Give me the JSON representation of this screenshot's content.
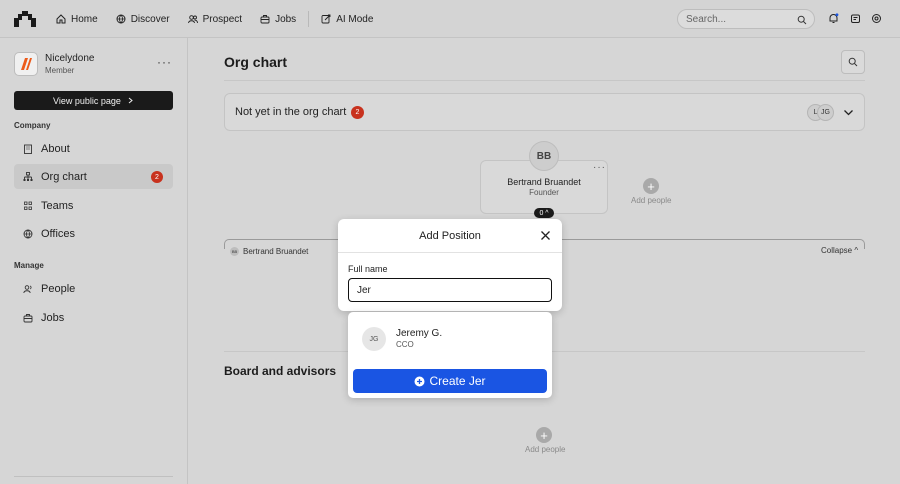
{
  "topnav": {
    "items": [
      {
        "label": "Home",
        "icon": "home-icon"
      },
      {
        "label": "Discover",
        "icon": "globe-icon"
      },
      {
        "label": "Prospect",
        "icon": "users-icon"
      },
      {
        "label": "Jobs",
        "icon": "briefcase-icon"
      },
      {
        "label": "AI Mode",
        "icon": "ai-icon"
      }
    ],
    "search_placeholder": "Search..."
  },
  "sidebar": {
    "company_name": "Nicelydone",
    "company_role": "Member",
    "more_label": "···",
    "public_button": "View public page",
    "company_section": "Company",
    "company_items": [
      {
        "label": "About",
        "icon": "building-icon"
      },
      {
        "label": "Org chart",
        "icon": "org-chart-icon",
        "badge": "2",
        "active": true
      },
      {
        "label": "Teams",
        "icon": "teams-icon"
      },
      {
        "label": "Offices",
        "icon": "globe-icon"
      }
    ],
    "manage_section": "Manage",
    "manage_items": [
      {
        "label": "People",
        "icon": "people-icon"
      },
      {
        "label": "Jobs",
        "icon": "briefcase-icon"
      }
    ]
  },
  "main": {
    "title": "Org chart",
    "not_yet": {
      "label": "Not yet in the org chart",
      "badge": "2",
      "avatars": [
        "L",
        "JG"
      ]
    },
    "root_person": {
      "initials": "BB",
      "name": "Bertrand Bruandet",
      "role": "Founder",
      "more": "···",
      "count": "0 ^"
    },
    "add_people_label": "Add people",
    "tree_row": {
      "initials": "BB",
      "name": "Bertrand Bruandet"
    },
    "collapse_label": "Collapse ^",
    "board_title": "Board and advisors",
    "board_add_label": "Add people"
  },
  "modal": {
    "title": "Add Position",
    "field_label": "Full name",
    "field_value": "Jer",
    "suggestion": {
      "initials": "JG",
      "name": "Jeremy G.",
      "role": "CCO"
    },
    "create_label": "Create Jer"
  },
  "colors": {
    "badge": "#c8321e",
    "primary": "#1a55e3",
    "dark_button": "#1a1a1a"
  }
}
